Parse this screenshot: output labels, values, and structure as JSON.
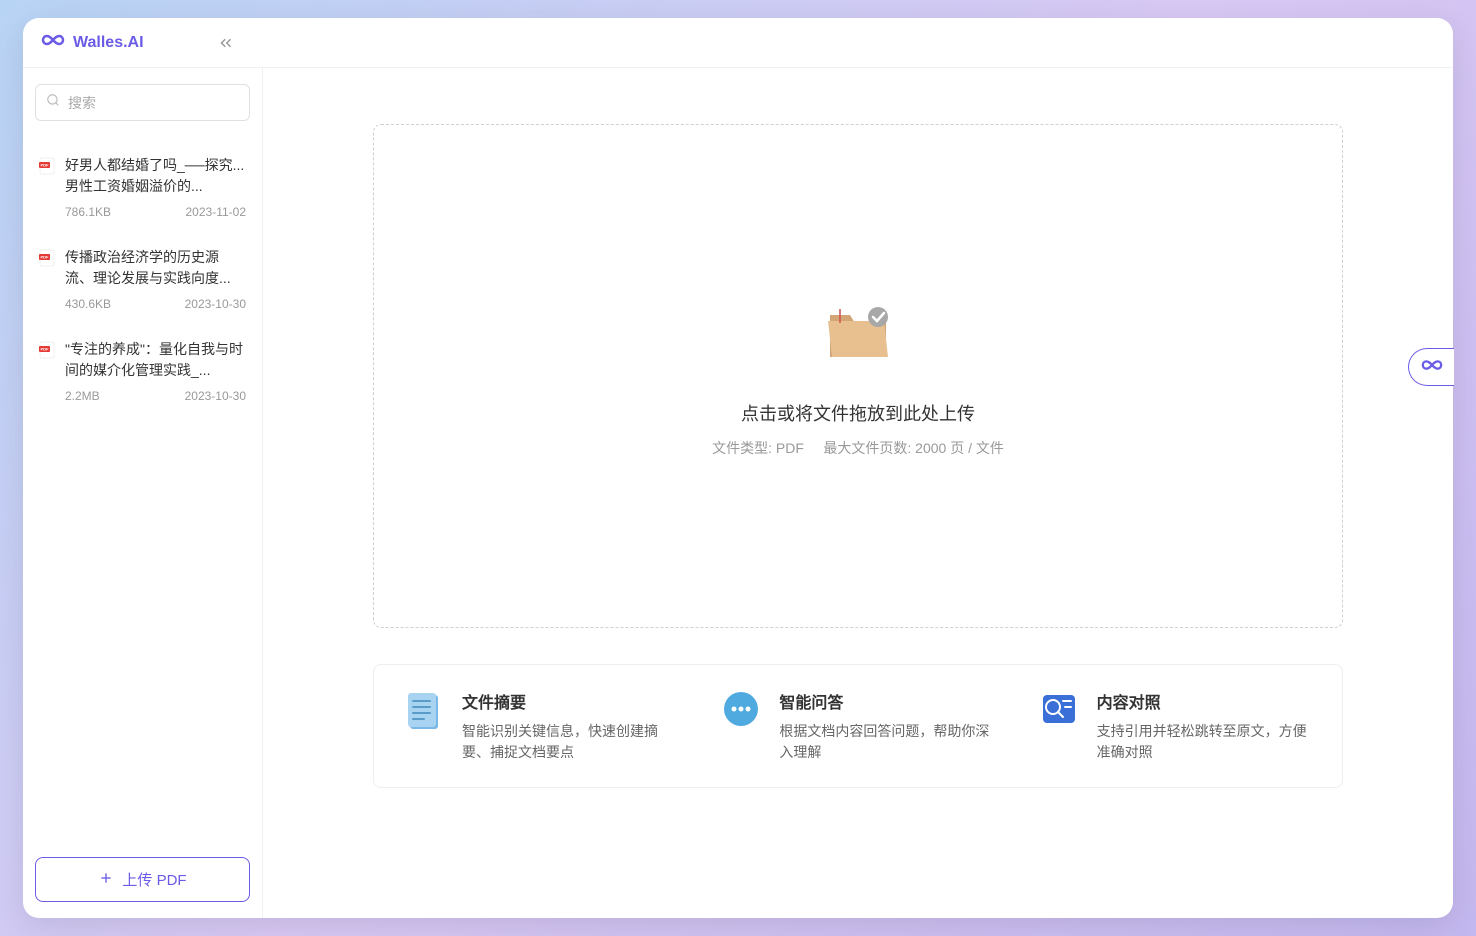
{
  "header": {
    "app_name": "Walles.AI"
  },
  "sidebar": {
    "search_placeholder": "搜索",
    "files": [
      {
        "title": "好男人都结婚了吗_──探究...男性工资婚姻溢价的...",
        "size": "786.1KB",
        "date": "2023-11-02"
      },
      {
        "title": "传播政治经济学的历史源流、理论发展与实践向度...",
        "size": "430.6KB",
        "date": "2023-10-30"
      },
      {
        "title": "\"专注的养成\"：量化自我与时间的媒介化管理实践_...",
        "size": "2.2MB",
        "date": "2023-10-30"
      }
    ],
    "upload_label": "上传 PDF"
  },
  "main": {
    "upload_prompt": "点击或将文件拖放到此处上传",
    "upload_meta_left": "文件类型: PDF",
    "upload_meta_right": "最大文件页数: 2000 页 / 文件",
    "features": [
      {
        "title": "文件摘要",
        "desc": "智能识别关键信息，快速创建摘要、捕捉文档要点"
      },
      {
        "title": "智能问答",
        "desc": "根据文档内容回答问题，帮助你深入理解"
      },
      {
        "title": "内容对照",
        "desc": "支持引用并轻松跳转至原文，方便准确对照"
      }
    ]
  }
}
